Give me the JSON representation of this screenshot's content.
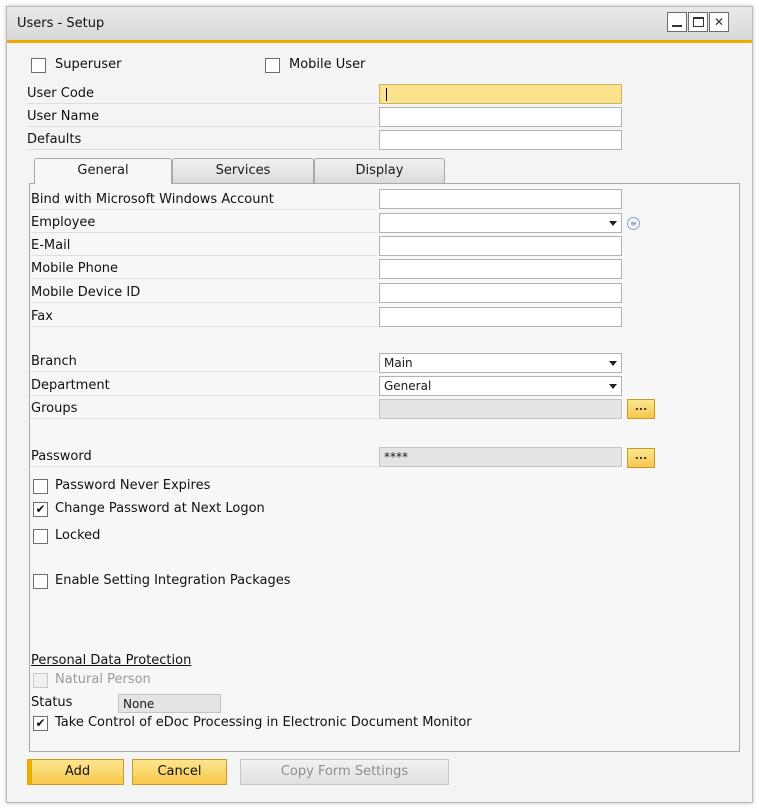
{
  "window": {
    "title": "Users - Setup"
  },
  "top": {
    "superuser_label": "Superuser",
    "mobile_user_label": "Mobile User",
    "superuser_checked": false,
    "mobile_user_checked": false,
    "user_code_label": "User Code",
    "user_code_value": "",
    "user_name_label": "User Name",
    "user_name_value": "",
    "defaults_label": "Defaults",
    "defaults_value": ""
  },
  "tabs": [
    {
      "label": "General",
      "active": true
    },
    {
      "label": "Services",
      "active": false
    },
    {
      "label": "Display",
      "active": false
    }
  ],
  "general": {
    "bind_windows_label": "Bind with Microsoft Windows Account",
    "bind_windows_value": "",
    "employee_label": "Employee",
    "employee_value": "",
    "email_label": "E-Mail",
    "email_value": "",
    "mobile_phone_label": "Mobile Phone",
    "mobile_phone_value": "",
    "mobile_device_label": "Mobile Device ID",
    "mobile_device_value": "",
    "fax_label": "Fax",
    "fax_value": "",
    "branch_label": "Branch",
    "branch_value": "Main",
    "department_label": "Department",
    "department_value": "General",
    "groups_label": "Groups",
    "groups_value": "",
    "groups_button": "...",
    "password_label": "Password",
    "password_value": "****",
    "password_button": "...",
    "pw_never_expires_label": "Password Never Expires",
    "pw_never_expires_checked": false,
    "change_pw_label": "Change Password at Next Logon",
    "change_pw_checked": true,
    "locked_label": "Locked",
    "locked_checked": false,
    "enable_integration_label": "Enable Setting Integration Packages",
    "enable_integration_checked": false,
    "pdp_heading": "Personal Data Protection",
    "natural_person_label": "Natural Person",
    "natural_person_checked": false,
    "status_label": "Status",
    "status_value": "None",
    "edoc_label": "Take Control of eDoc Processing in Electronic Document Monitor",
    "edoc_checked": true,
    "check_glyph": "✔"
  },
  "footer": {
    "add_label": "Add",
    "cancel_label": "Cancel",
    "copy_form_label": "Copy Form Settings"
  },
  "icons": {
    "dropdown": "chevron-down-icon",
    "info": "list-icon"
  },
  "colors": {
    "accent": "#f0ab00",
    "active_field": "#fbe38c",
    "button": "#f6c74b"
  }
}
